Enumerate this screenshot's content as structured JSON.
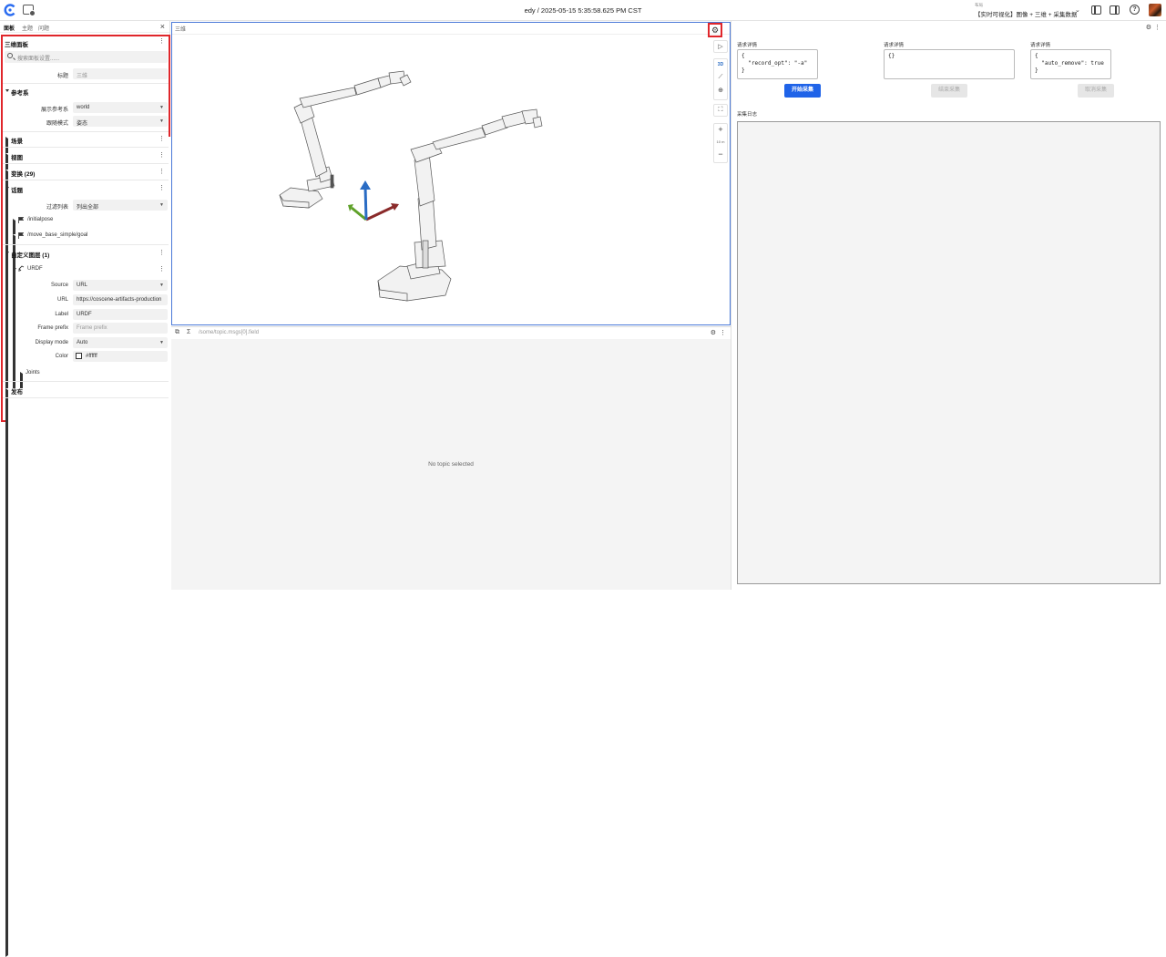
{
  "topbar": {
    "title": "edy / 2025-05-15 5:35:58.625 PM CST",
    "layout_small": "布局",
    "layout_name": "【实时可视化】图像 + 三维 + 采集数据"
  },
  "left": {
    "tabs": [
      "面板",
      "主题",
      "问题"
    ],
    "panel_title": "三维面板",
    "search_placeholder": "搜索面板设置......",
    "title_label": "标题",
    "title_value": "三维",
    "frame_section": "参考系",
    "display_frame_label": "展示参考系",
    "display_frame_value": "world",
    "follow_mode_label": "跟随模式",
    "follow_mode_value": "姿态",
    "scene": "场景",
    "view": "视图",
    "transforms": "变换 (29)",
    "topics": "话题",
    "filter_label": "过滤列表",
    "filter_value": "列出全部",
    "topic_items": [
      "/initialpose",
      "/move_base_simple/goal"
    ],
    "custom_layers": "自定义图层 (1)",
    "urdf": {
      "name": "URDF",
      "source_label": "Source",
      "source_value": "URL",
      "url_label": "URL",
      "url_value": "https://coscene-artifacts-production",
      "label_label": "Label",
      "label_value": "URDF",
      "frame_prefix_label": "Frame prefix",
      "frame_prefix_placeholder": "Frame prefix",
      "display_mode_label": "Display mode",
      "display_mode_value": "Auto",
      "color_label": "Color",
      "color_value": "#ffffff",
      "joints": "Joints"
    },
    "publish": "发布"
  },
  "view3d": {
    "title": "三维",
    "tool_3d": "3D",
    "scale": "10 m"
  },
  "plot": {
    "path_placeholder": "/some/topic.msgs[0].field",
    "empty_message": "No topic selected"
  },
  "right": {
    "col1_label": "请求详情",
    "col1_code": "{\n  \"record_opt\": \"-a\"\n}",
    "col1_button": "开始采集",
    "col2_label": "请求详情",
    "col2_code": "{}",
    "col2_button": "结束采集",
    "col3_label": "请求详情",
    "col3_code": "{\n  \"auto_remove\": true\n}",
    "col3_button": "取消采集",
    "log_label": "采集日志"
  },
  "colors": {
    "accent": "#1f63e8",
    "highlight": "#e0262b",
    "focus_border": "#4a79d8"
  }
}
